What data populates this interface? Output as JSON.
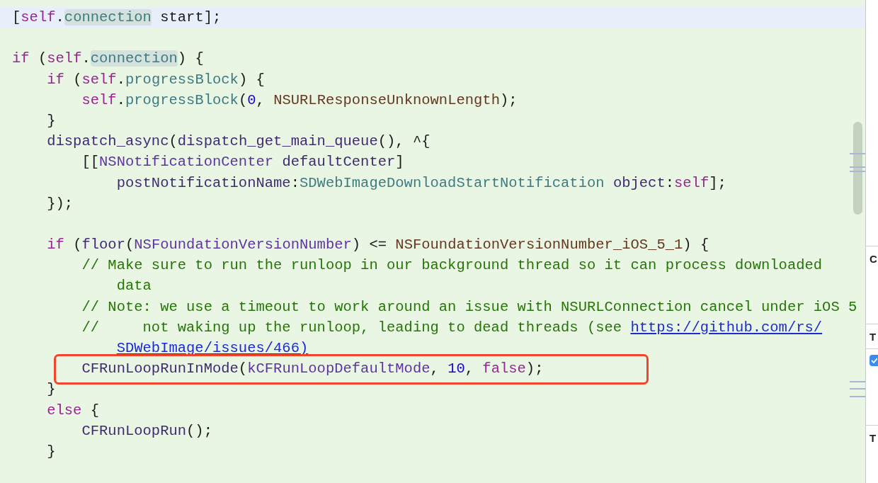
{
  "editor": {
    "rows": [
      {
        "current": true,
        "annotated": false,
        "tokens": [
          {
            "text": "[",
            "kind": "plain"
          },
          {
            "text": "self",
            "kind": "keyword"
          },
          {
            "text": ".",
            "kind": "plain"
          },
          {
            "text": "connection",
            "kind": "occurrence"
          },
          {
            "text": " start];",
            "kind": "plain"
          }
        ]
      },
      {
        "current": false,
        "annotated": false
      },
      {
        "current": false,
        "annotated": false,
        "tokens": [
          {
            "text": "if",
            "kind": "keyword"
          },
          {
            "text": " (",
            "kind": "plain"
          },
          {
            "text": "self",
            "kind": "keyword"
          },
          {
            "text": ".",
            "kind": "plain"
          },
          {
            "text": "connection",
            "kind": "occurrence"
          },
          {
            "text": ") {",
            "kind": "plain"
          }
        ]
      },
      {
        "current": false,
        "annotated": false,
        "tokens": [
          {
            "text": "    if",
            "kind": "keyword"
          },
          {
            "text": " (",
            "kind": "plain"
          },
          {
            "text": "self",
            "kind": "keyword"
          },
          {
            "text": ".",
            "kind": "plain"
          },
          {
            "text": "progressBlock",
            "kind": "property"
          },
          {
            "text": ") {",
            "kind": "plain"
          }
        ]
      },
      {
        "current": false,
        "annotated": false,
        "tokens": [
          {
            "text": "        self",
            "kind": "keyword"
          },
          {
            "text": ".",
            "kind": "plain"
          },
          {
            "text": "progressBlock",
            "kind": "property"
          },
          {
            "text": "(",
            "kind": "plain"
          },
          {
            "text": "0",
            "kind": "number"
          },
          {
            "text": ", ",
            "kind": "plain"
          },
          {
            "text": "NSURLResponseUnknownLength",
            "kind": "constant"
          },
          {
            "text": ");",
            "kind": "plain"
          }
        ]
      },
      {
        "current": false,
        "annotated": false,
        "tokens": [
          {
            "text": "    }",
            "kind": "plain"
          }
        ]
      },
      {
        "current": false,
        "annotated": false,
        "tokens": [
          {
            "text": "    dispatch_async",
            "kind": "function"
          },
          {
            "text": "(",
            "kind": "plain"
          },
          {
            "text": "dispatch_get_main_queue",
            "kind": "function"
          },
          {
            "text": "(), ^{",
            "kind": "plain"
          }
        ]
      },
      {
        "current": false,
        "annotated": false,
        "tokens": [
          {
            "text": "        [[",
            "kind": "plain"
          },
          {
            "text": "NSNotificationCenter",
            "kind": "type"
          },
          {
            "text": " defaultCenter",
            "kind": "function"
          },
          {
            "text": "]",
            "kind": "plain"
          }
        ]
      },
      {
        "current": false,
        "annotated": false,
        "tokens": [
          {
            "text": "            postNotificationName",
            "kind": "function"
          },
          {
            "text": ":",
            "kind": "plain"
          },
          {
            "text": "SDWebImageDownloadStartNotification",
            "kind": "property"
          },
          {
            "text": " object",
            "kind": "function"
          },
          {
            "text": ":",
            "kind": "plain"
          },
          {
            "text": "self",
            "kind": "keyword"
          },
          {
            "text": "];",
            "kind": "plain"
          }
        ]
      },
      {
        "current": false,
        "annotated": false,
        "tokens": [
          {
            "text": "    });",
            "kind": "plain"
          }
        ]
      },
      {
        "current": false,
        "annotated": false
      },
      {
        "current": false,
        "annotated": false,
        "tokens": [
          {
            "text": "    if",
            "kind": "keyword"
          },
          {
            "text": " (",
            "kind": "plain"
          },
          {
            "text": "floor",
            "kind": "function"
          },
          {
            "text": "(",
            "kind": "plain"
          },
          {
            "text": "NSFoundationVersionNumber",
            "kind": "type"
          },
          {
            "text": ") <= ",
            "kind": "plain"
          },
          {
            "text": "NSFoundationVersionNumber_iOS_5_1",
            "kind": "constant"
          },
          {
            "text": ") {",
            "kind": "plain"
          }
        ]
      },
      {
        "current": false,
        "annotated": false,
        "tokens": [
          {
            "text": "        // Make sure to run the runloop in our background thread so it can process downloaded",
            "kind": "comment"
          }
        ]
      },
      {
        "current": false,
        "annotated": false,
        "tokens": [
          {
            "text": "            data",
            "kind": "comment"
          }
        ]
      },
      {
        "current": false,
        "annotated": false,
        "tokens": [
          {
            "text": "        // Note: we use a timeout to work around an issue with NSURLConnection cancel under iOS 5",
            "kind": "comment"
          }
        ]
      },
      {
        "current": false,
        "annotated": false,
        "tokens": [
          {
            "text": "        //     not waking up the runloop, leading to dead threads (see ",
            "kind": "comment"
          },
          {
            "text": "https://github.com/rs/",
            "kind": "link"
          }
        ]
      },
      {
        "current": false,
        "annotated": false,
        "tokens": [
          {
            "text": "            SDWebImage/issues/466)",
            "kind": "link"
          }
        ]
      },
      {
        "current": false,
        "annotated": true,
        "tokens": [
          {
            "text": "        CFRunLoopRunInMode",
            "kind": "function"
          },
          {
            "text": "(",
            "kind": "plain"
          },
          {
            "text": "kCFRunLoopDefaultMode",
            "kind": "type"
          },
          {
            "text": ", ",
            "kind": "plain"
          },
          {
            "text": "10",
            "kind": "number"
          },
          {
            "text": ", ",
            "kind": "plain"
          },
          {
            "text": "false",
            "kind": "keyword"
          },
          {
            "text": ");",
            "kind": "plain"
          }
        ]
      },
      {
        "current": false,
        "annotated": false,
        "tokens": [
          {
            "text": "    }",
            "kind": "plain"
          }
        ]
      },
      {
        "current": false,
        "annotated": false,
        "tokens": [
          {
            "text": "    else",
            "kind": "keyword"
          },
          {
            "text": " {",
            "kind": "plain"
          }
        ]
      },
      {
        "current": false,
        "annotated": false,
        "tokens": [
          {
            "text": "        CFRunLoopRun",
            "kind": "function"
          },
          {
            "text": "();",
            "kind": "plain"
          }
        ]
      },
      {
        "current": false,
        "annotated": false,
        "tokens": [
          {
            "text": "    }",
            "kind": "plain"
          }
        ]
      }
    ]
  },
  "inspector": {
    "sections": [
      {
        "heading": "C"
      },
      {
        "heading": "T",
        "checkbox": {
          "checked": true
        }
      },
      {
        "heading": "T"
      }
    ]
  }
}
